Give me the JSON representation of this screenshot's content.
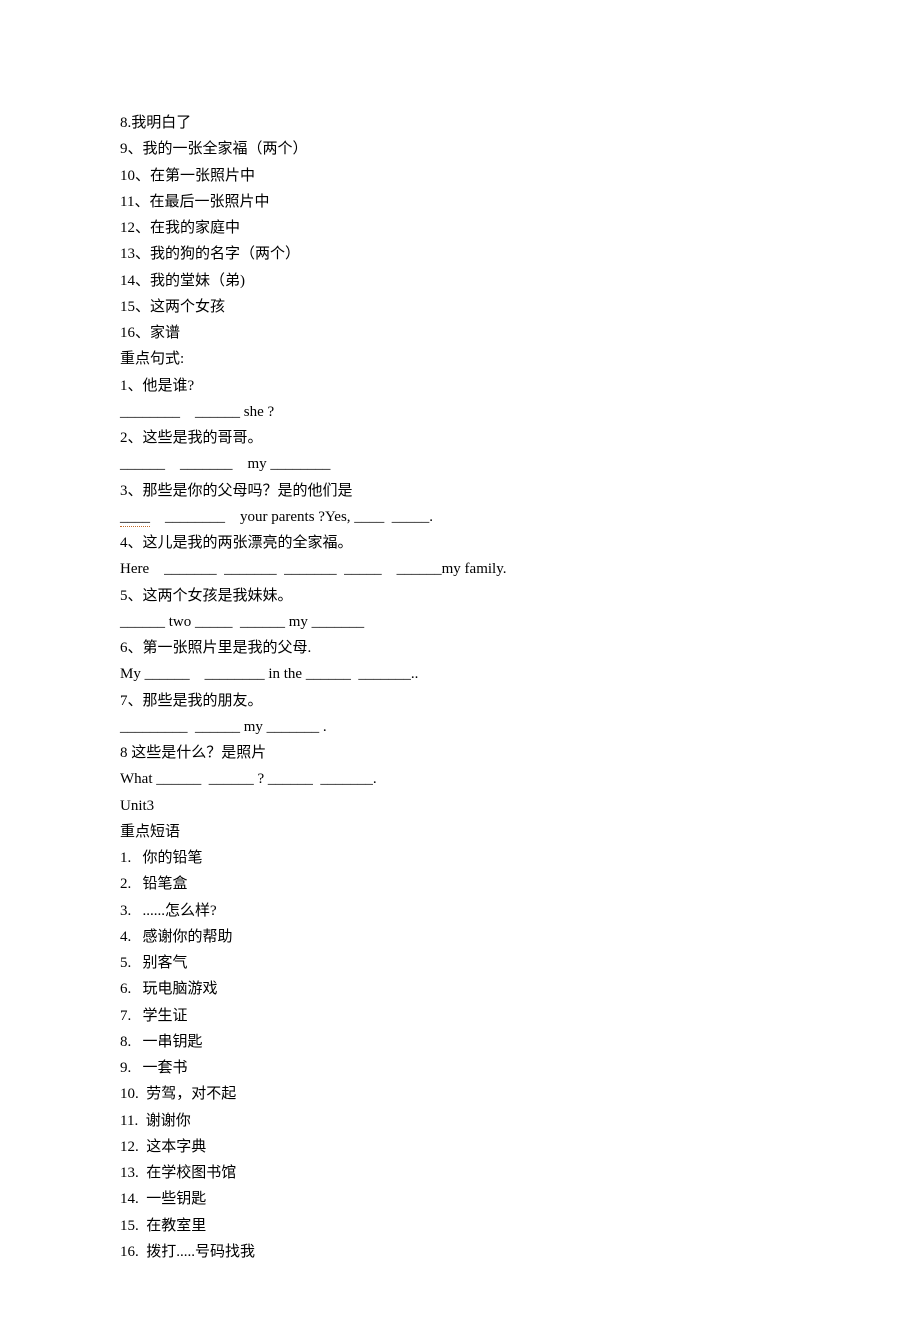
{
  "lines": [
    {
      "text": "8.我明白了"
    },
    {
      "text": "9、我的一张全家福（两个）"
    },
    {
      "text": "10、在第一张照片中"
    },
    {
      "text": "11、在最后一张照片中"
    },
    {
      "text": "12、在我的家庭中"
    },
    {
      "text": "13、我的狗的名字（两个）"
    },
    {
      "text": "14、我的堂妹（弟)"
    },
    {
      "text": "15、这两个女孩"
    },
    {
      "text": "16、家谱"
    },
    {
      "text": "重点句式:"
    },
    {
      "text": "1、他是谁?"
    },
    {
      "text": "________    ______ she ?"
    },
    {
      "text": "2、这些是我的哥哥。"
    },
    {
      "text": "______    _______    my ________"
    },
    {
      "text": "3、那些是你的父母吗？是的他们是"
    },
    {
      "text": "____",
      "dotted": true,
      "suffix": "    ________    your parents ?Yes, ____  _____."
    },
    {
      "text": "4、这儿是我的两张漂亮的全家福。"
    },
    {
      "text": "Here    _______  _______  _______  _____    ______my family."
    },
    {
      "text": "5、这两个女孩是我妹妹。"
    },
    {
      "text": "______ two _____  ______ my _______"
    },
    {
      "text": "6、第一张照片里是我的父母."
    },
    {
      "text": "My ______    ________ in the ______  _______.."
    },
    {
      "text": "7、那些是我的朋友。"
    },
    {
      "text": "_________  ______ my _______ ."
    },
    {
      "text": "8 这些是什么？是照片"
    },
    {
      "text": "What ______  ______ ? ______  _______."
    },
    {
      "text": "Unit3"
    },
    {
      "text": "重点短语"
    },
    {
      "indent": true,
      "text": "1.   你的铅笔"
    },
    {
      "indent": true,
      "text": "2.   铅笔盒"
    },
    {
      "indent": true,
      "text": "3.   ......怎么样?"
    },
    {
      "indent": true,
      "text": "4.   感谢你的帮助"
    },
    {
      "indent": true,
      "text": "5.   别客气"
    },
    {
      "indent": true,
      "text": "6.   玩电脑游戏"
    },
    {
      "indent": true,
      "text": "7.   学生证"
    },
    {
      "indent": true,
      "text": "8.   一串钥匙"
    },
    {
      "indent": true,
      "text": "9.   一套书"
    },
    {
      "indent": true,
      "text": "10.  劳驾，对不起"
    },
    {
      "indent": true,
      "text": "11.  谢谢你"
    },
    {
      "indent": true,
      "text": "12.  这本字典"
    },
    {
      "indent": true,
      "text": "13.  在学校图书馆"
    },
    {
      "indent": true,
      "text": "14.  一些钥匙"
    },
    {
      "indent": true,
      "text": "15.  在教室里"
    },
    {
      "indent": true,
      "text": "16.  拨打.....号码找我"
    }
  ]
}
